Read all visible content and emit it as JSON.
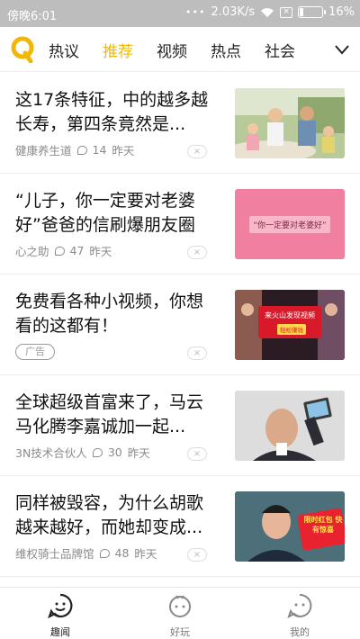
{
  "status_bar": {
    "time": "傍晚6:01",
    "dots": "•••",
    "speed": "2.03K/s",
    "battery": "16%",
    "battery_level": 0.16
  },
  "tabs": [
    {
      "label": "热议",
      "active": false
    },
    {
      "label": "推荐",
      "active": true
    },
    {
      "label": "视频",
      "active": false
    },
    {
      "label": "热点",
      "active": false
    },
    {
      "label": "社会",
      "active": false
    }
  ],
  "feed": [
    {
      "title": "这17条特征，中的越多越长寿，第四条竟然是...",
      "source": "健康养生道",
      "comments": "14",
      "time": "昨天"
    },
    {
      "title": "“儿子，你一定要对老婆好”爸爸的信刷爆朋友圈",
      "source": "心之助",
      "comments": "47",
      "time": "昨天",
      "thumb_text": "“你一定要对老婆好”"
    },
    {
      "title": "免费看各种小视频，你想看的这都有！",
      "ad_label": "广告",
      "thumb_text": "来火山发现视频",
      "thumb_button": "轻松赚钱"
    },
    {
      "title": "全球超级首富来了，马云马化腾李嘉诚加一起...",
      "source": "3N技术合伙人",
      "comments": "30",
      "time": "昨天"
    },
    {
      "title": "同样被毁容，为什么胡歌越来越好，而她却变成...",
      "source": "维权骑士品牌馆",
      "comments": "48",
      "time": "昨天",
      "thumb_text": "限时红包 快有惊喜"
    }
  ],
  "bottom_nav": [
    {
      "label": "趣闻",
      "active": true
    },
    {
      "label": "好玩",
      "active": false
    },
    {
      "label": "我的",
      "active": false
    }
  ],
  "colors": {
    "accent": "#f2b705",
    "status_bar": "#bdbdbd"
  }
}
